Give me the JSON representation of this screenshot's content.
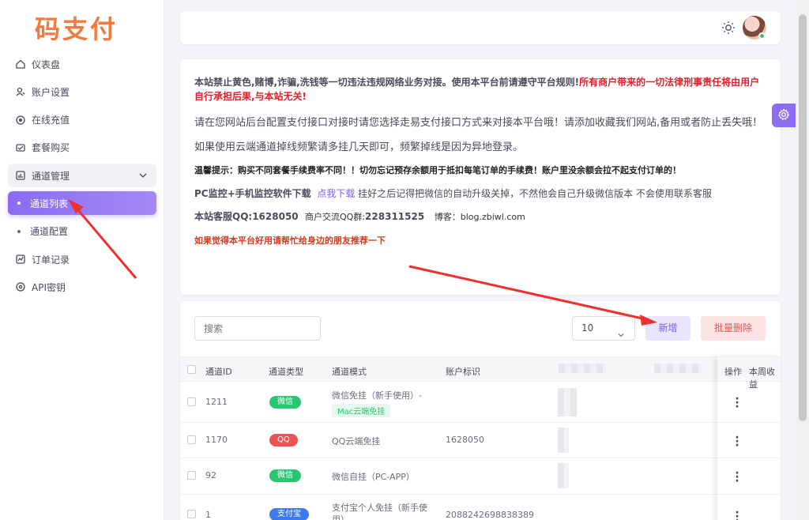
{
  "brand": {
    "logo": "码支付"
  },
  "sidebar": {
    "items": [
      {
        "label": "仪表盘",
        "icon": "home-icon"
      },
      {
        "label": "账户设置",
        "icon": "user-icon"
      },
      {
        "label": "在线充值",
        "icon": "coin-icon"
      },
      {
        "label": "套餐购买",
        "icon": "package-icon"
      },
      {
        "label": "通道管理",
        "icon": "chart-icon"
      },
      {
        "label": "通道列表",
        "icon": "dot"
      },
      {
        "label": "通道配置",
        "icon": "dot"
      },
      {
        "label": "订单记录",
        "icon": "order-icon"
      },
      {
        "label": "API密钥",
        "icon": "key-icon"
      }
    ],
    "active": "通道列表"
  },
  "notice": {
    "l1_normal": "本站禁止黄色,赌博,诈骗,洗钱等一切违法违规网络业务对接。使用本平台前请遵守平台规则!",
    "l1_red": "所有商户带来的一切法律刑事责任将由用户自行承担后果,与本站无关!",
    "l2": "请在您网站后台配置支付接口对接时请您选择走易支付接口方式来对接本平台哦！请添加收藏我们网站,备用或者防止丢失哦！",
    "l3": "如果使用云端通道掉线频繁请多挂几天即可，频繁掉线是因为异地登录。",
    "l4": "温馨提示：购买不同套餐手续费率不同！！切勿忘记预存余额用于抵扣每笔订单的手续费！账户里没余额会拉不起支付订单的！",
    "l5_a": "PC监控+手机监控软件下载",
    "l5_link": "点我下载",
    "l5_b": "挂好之后记得把微信的自动升级关掉，不然他会自己升级微信版本 不会使用联系客服",
    "l6_a": "本站客服QQ:1628050",
    "l6_b": "商户交流QQ群:",
    "l6_c": "228311525",
    "l6_d": "博客：blog.zbiwl.com",
    "l7": "如果觉得本平台好用请帮忙给身边的朋友推荐一下"
  },
  "toolbar": {
    "search_placeholder": "搜索",
    "page_size": "10",
    "add_label": "新增",
    "batch_delete_label": "批量删除"
  },
  "table": {
    "headers": [
      "通道ID",
      "通道类型",
      "通道模式",
      "账户标识",
      "操作",
      "本周收益"
    ],
    "rows": [
      {
        "id": "1211",
        "type": "微信",
        "type_color": "#28c76f",
        "mode": "微信免挂（新手使用）-",
        "mode_tag": "Mac云端免挂",
        "account": ""
      },
      {
        "id": "1170",
        "type": "QQ",
        "type_color": "#ea5455",
        "mode": "QQ云端免挂",
        "mode_tag": "",
        "account": "1628050"
      },
      {
        "id": "92",
        "type": "微信",
        "type_color": "#28c76f",
        "mode": "微信自挂（PC-APP）",
        "mode_tag": "",
        "account": ""
      },
      {
        "id": "1",
        "type": "支付宝",
        "type_color": "#3d7af0",
        "mode": "支付宝个人免挂（新手使用）",
        "mode_tag": "",
        "account": "2088242698838389"
      }
    ]
  }
}
